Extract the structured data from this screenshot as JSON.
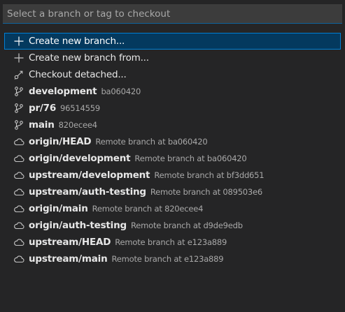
{
  "input": {
    "placeholder": "Select a branch or tag to checkout",
    "value": ""
  },
  "colors": {
    "selected_background": "#04395e",
    "focus_border": "#007fd4",
    "input_background": "#3c3c3c"
  },
  "items": [
    {
      "icon": "plus-icon",
      "label": "Create new branch...",
      "description": ""
    },
    {
      "icon": "plus-icon",
      "label": "Create new branch from...",
      "description": ""
    },
    {
      "icon": "git-commit-detached-icon",
      "label": "Checkout detached...",
      "description": ""
    },
    {
      "icon": "git-branch-icon",
      "label": "development",
      "description": "ba060420"
    },
    {
      "icon": "git-branch-icon",
      "label": "pr/76",
      "description": "96514559"
    },
    {
      "icon": "git-branch-icon",
      "label": "main",
      "description": "820ecee4"
    },
    {
      "icon": "cloud-icon",
      "label": "origin/HEAD",
      "description": "Remote branch at ba060420"
    },
    {
      "icon": "cloud-icon",
      "label": "origin/development",
      "description": "Remote branch at ba060420"
    },
    {
      "icon": "cloud-icon",
      "label": "upstream/development",
      "description": "Remote branch at bf3dd651"
    },
    {
      "icon": "cloud-icon",
      "label": "upstream/auth-testing",
      "description": "Remote branch at 089503e6"
    },
    {
      "icon": "cloud-icon",
      "label": "origin/main",
      "description": "Remote branch at 820ecee4"
    },
    {
      "icon": "cloud-icon",
      "label": "origin/auth-testing",
      "description": "Remote branch at d9de9edb"
    },
    {
      "icon": "cloud-icon",
      "label": "upstream/HEAD",
      "description": "Remote branch at e123a889"
    },
    {
      "icon": "cloud-icon",
      "label": "upstream/main",
      "description": "Remote branch at e123a889"
    }
  ]
}
